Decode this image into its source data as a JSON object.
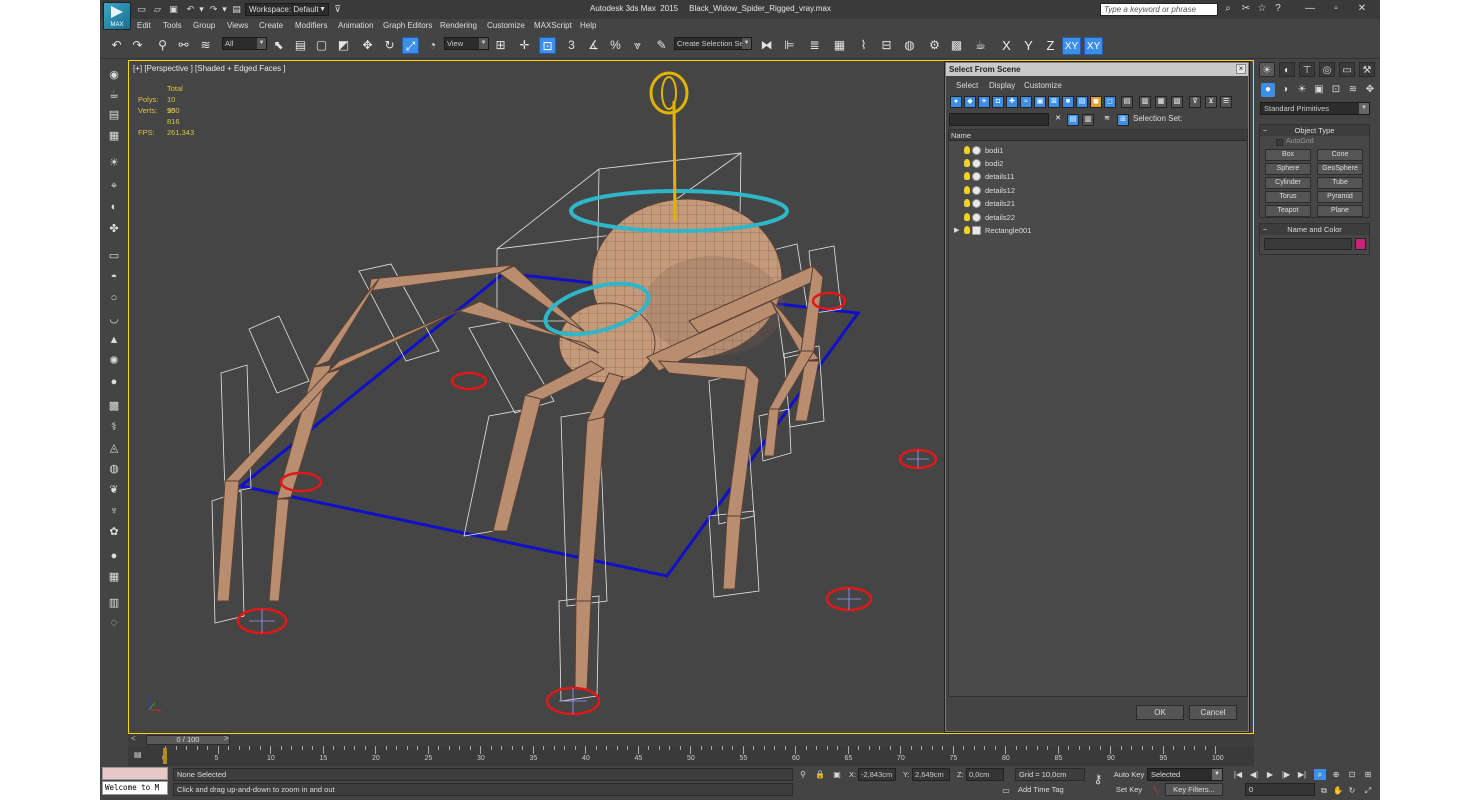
{
  "titlebar": {
    "workspace": "Workspace: Default",
    "app_title": "Autodesk 3ds Max  2015     Black_Widow_Spider_Rigged_vray.max",
    "search_placeholder": "Type a keyword or phrase",
    "logo_text": "MAX"
  },
  "menu": [
    "Edit",
    "Tools",
    "Group",
    "Views",
    "Create",
    "Modifiers",
    "Animation",
    "Graph Editors",
    "Rendering",
    "Customize",
    "MAXScript",
    "Help"
  ],
  "toolbar": {
    "selection_filter": "All",
    "reference_coord": "View",
    "named_selection": "Create Selection Se",
    "snaps_label": "3",
    "axis_x": "X",
    "axis_y": "Y",
    "axis_z": "Z",
    "axis_xy": "XY",
    "axis_xy2": "XY"
  },
  "viewport": {
    "label": "[+] [Perspective ] [Shaded + Edged Faces ]",
    "stats": {
      "total_label": "Total",
      "polys_label": "Polys:",
      "polys_value": "10 950",
      "verts_label": "Verts:",
      "verts_value": "10 816",
      "fps_label": "FPS:",
      "fps_value": "261,343"
    }
  },
  "dialog": {
    "title": "Select From Scene",
    "menu": [
      "Select",
      "Display",
      "Customize"
    ],
    "selection_set_label": "Selection Set:",
    "list_header": "Name",
    "objects": [
      "bodi1",
      "bodi2",
      "details11",
      "details12",
      "details21",
      "details22",
      "Rectangle001"
    ],
    "ok_label": "OK",
    "cancel_label": "Cancel"
  },
  "command_panel": {
    "category": "Standard Primitives",
    "object_type_title": "Object Type",
    "autogrid_label": "AutoGrid",
    "primitives": [
      "Box",
      "Cone",
      "Sphere",
      "GeoSphere",
      "Cylinder",
      "Tube",
      "Torus",
      "Pyramid",
      "Teapot",
      "Plane"
    ],
    "name_color_title": "Name and Color",
    "object_color": "#c0287a"
  },
  "timeline": {
    "slider_text": "0 / 100",
    "ticks": [
      "0",
      "5",
      "10",
      "15",
      "20",
      "25",
      "30",
      "35",
      "40",
      "45",
      "50",
      "55",
      "60",
      "65",
      "70",
      "75",
      "80",
      "85",
      "90",
      "95",
      "100"
    ]
  },
  "statusbar": {
    "maxscript_text": "Welcome to M",
    "selection_status": "None Selected",
    "prompt": "Click and drag up-and-down to zoom in and out",
    "x_label": "X:",
    "x_value": "-2,843cm",
    "y_label": "Y:",
    "y_value": "2,649cm",
    "z_label": "Z:",
    "z_value": "0,0cm",
    "grid": "Grid = 10,0cm",
    "add_time_tag": "Add Time Tag",
    "auto_key": "Auto Key",
    "set_key": "Set Key",
    "selected": "Selected",
    "key_filters": "Key Filters...",
    "current_frame": "0"
  },
  "colors": {
    "accent": "#3d8ee6",
    "viewport_border": "#ffd400",
    "spider_skin": "#c49a7b",
    "ring_control": "#2fb6c9",
    "foot_control": "#e01818",
    "rectangle": "#1010c8",
    "top_control": "#e0b400"
  }
}
